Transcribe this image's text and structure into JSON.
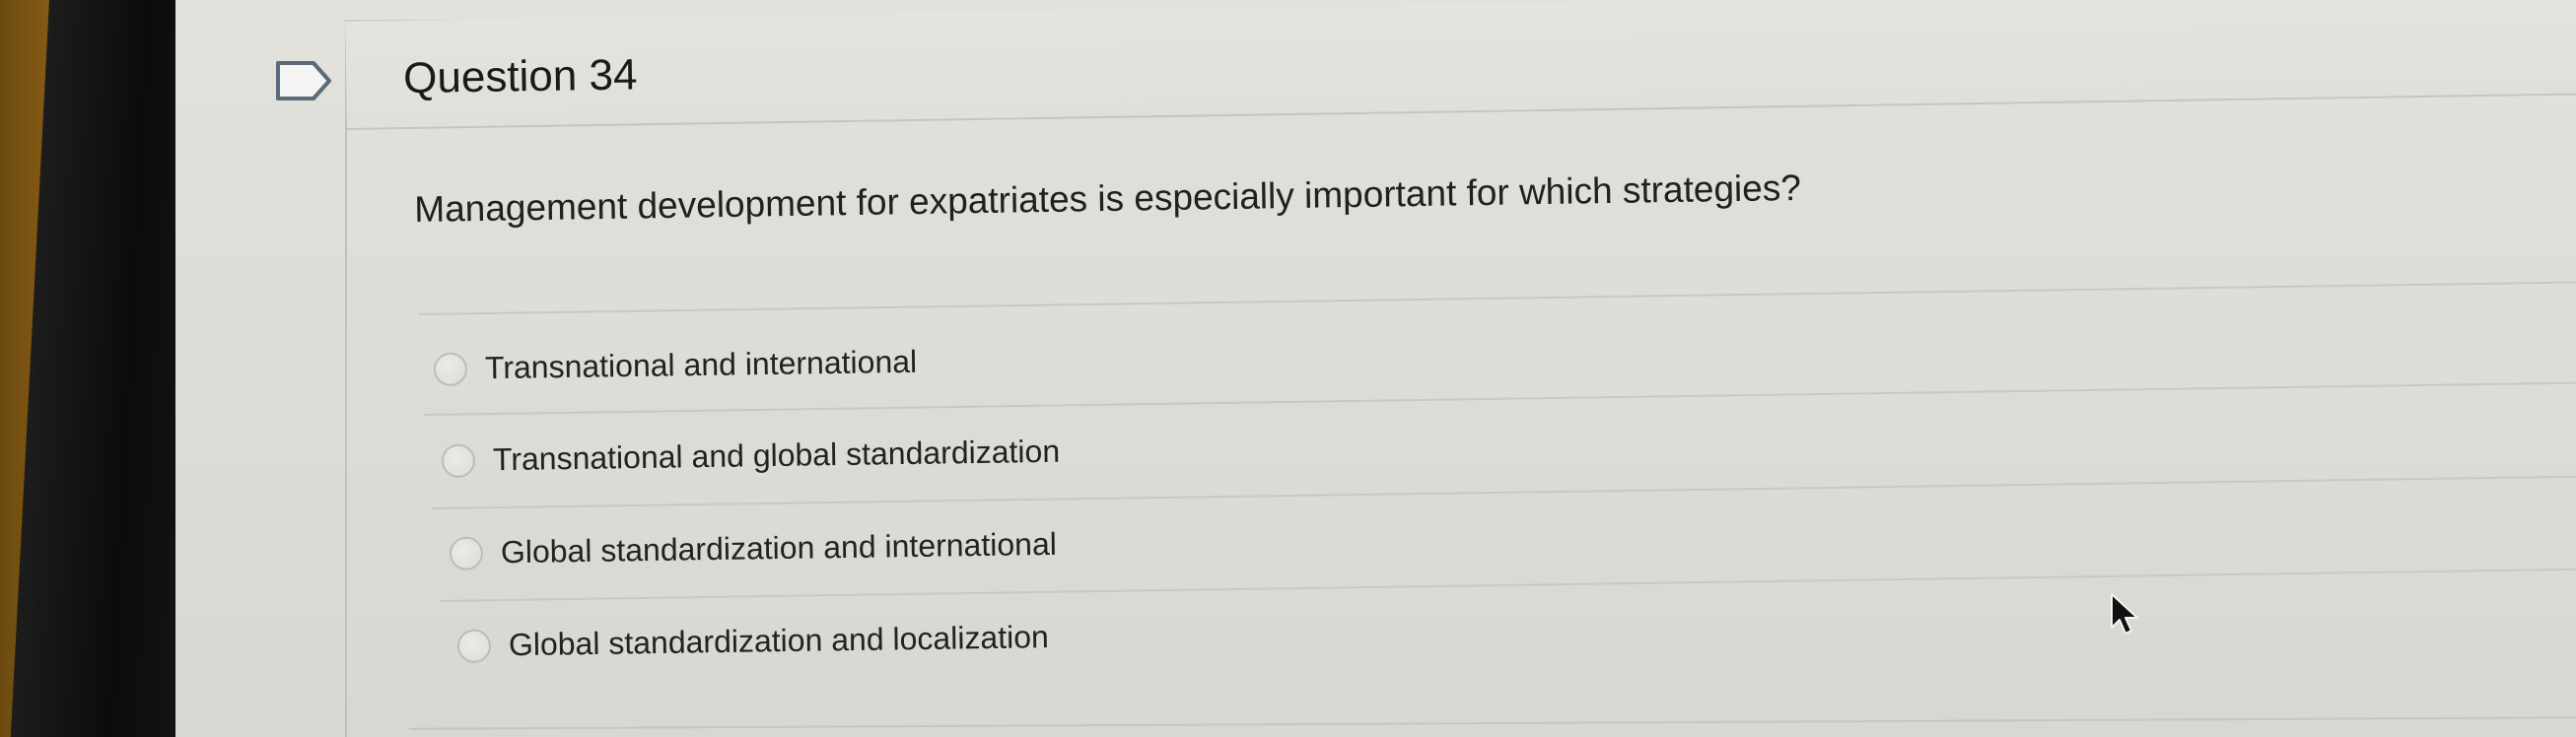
{
  "question": {
    "title": "Question 34",
    "prompt": "Management development for expatriates is especially important for which strategies?",
    "options": [
      {
        "label": "Transnational and international",
        "selected": false
      },
      {
        "label": "Transnational and global standardization",
        "selected": false
      },
      {
        "label": "Global standardization and international",
        "selected": false
      },
      {
        "label": "Global standardization and localization",
        "selected": false
      }
    ]
  },
  "icons": {
    "flag": "flag-icon",
    "cursor": "cursor-arrow-icon",
    "radio": "radio-button-icon"
  },
  "colors": {
    "screen_background": "#e0dfda",
    "text": "#202020",
    "divider": "#c9c8c2",
    "bezel": "#111111",
    "desk": "#8a5e14"
  }
}
